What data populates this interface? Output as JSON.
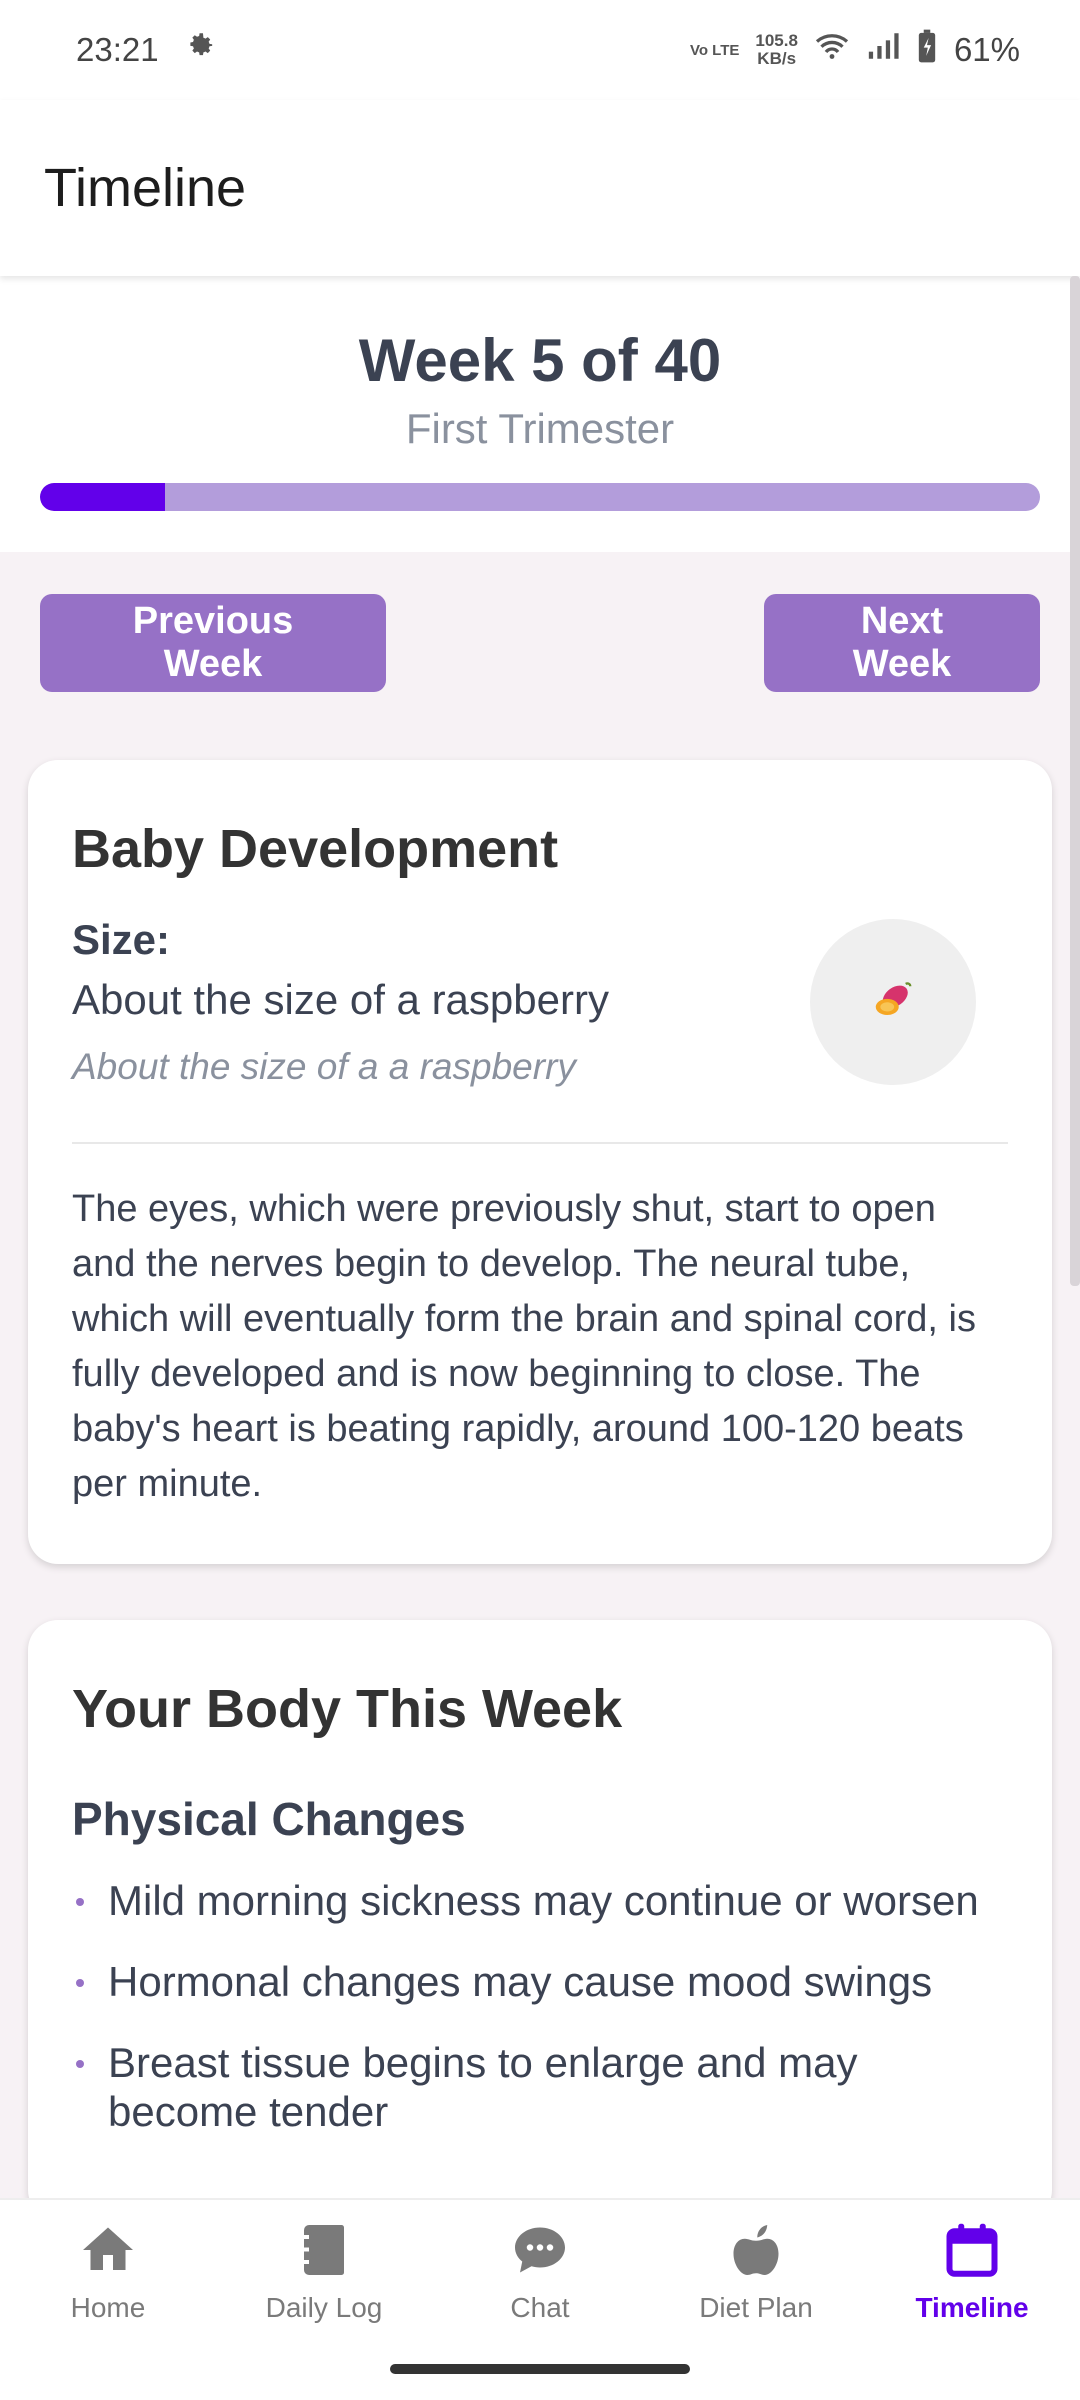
{
  "status_bar": {
    "time": "23:21",
    "volte": "Vo LTE",
    "net_speed_value": "105.8",
    "net_speed_unit": "KB/s",
    "battery": "61%",
    "icons": [
      "settings-gear-icon",
      "wifi-icon",
      "signal-icon",
      "battery-charging-icon"
    ]
  },
  "app_bar": {
    "title": "Timeline"
  },
  "week_header": {
    "title": "Week 5 of 40",
    "trimester": "First Trimester",
    "progress": 0.125
  },
  "nav_buttons": {
    "previous": "Previous Week",
    "next": "Next Week"
  },
  "baby_development": {
    "title": "Baby Development",
    "size_label": "Size:",
    "size_text": "About the size of a raspberry",
    "size_subtext": "About the size of a a raspberry",
    "size_icon": "sweet-potato-icon",
    "description": "The eyes, which were previously shut, start to open and the nerves begin to develop. The neural tube, which will eventually form the brain and spinal cord, is fully developed and is now beginning to close. The baby's heart is beating rapidly, around 100-120 beats per minute."
  },
  "your_body": {
    "title": "Your Body This Week",
    "section_title": "Physical Changes",
    "changes": [
      "Mild morning sickness may continue or worsen",
      "Hormonal changes may cause mood swings",
      "Breast tissue begins to enlarge and may become tender"
    ]
  },
  "bottom_nav": {
    "items": [
      {
        "label": "Home",
        "icon": "home-icon"
      },
      {
        "label": "Daily Log",
        "icon": "journal-icon"
      },
      {
        "label": "Chat",
        "icon": "chat-bubble-icon"
      },
      {
        "label": "Diet Plan",
        "icon": "apple-icon"
      },
      {
        "label": "Timeline",
        "icon": "calendar-icon"
      }
    ],
    "active": "Timeline"
  },
  "colors": {
    "accent": "#6200ea",
    "button": "#9671c6",
    "progress_track": "#b39ddb",
    "background": "#f7f2f5"
  }
}
